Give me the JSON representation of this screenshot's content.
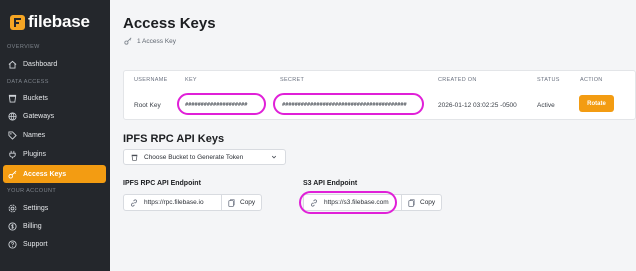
{
  "brand": {
    "name": "filebase",
    "accent": "#f39c12"
  },
  "sidebar": {
    "sections": {
      "overview": "OVERVIEW",
      "data_access": "DATA ACCESS",
      "your_account": "YOUR ACCOUNT"
    },
    "items": [
      {
        "label": "Dashboard",
        "icon": "home-icon"
      },
      {
        "label": "Buckets",
        "icon": "bucket-icon"
      },
      {
        "label": "Gateways",
        "icon": "globe-icon"
      },
      {
        "label": "Names",
        "icon": "tag-icon"
      },
      {
        "label": "Plugins",
        "icon": "plug-icon"
      },
      {
        "label": "Access Keys",
        "icon": "key-icon",
        "active": true
      },
      {
        "label": "Settings",
        "icon": "gear-icon"
      },
      {
        "label": "Billing",
        "icon": "billing-icon"
      },
      {
        "label": "Support",
        "icon": "help-icon"
      }
    ]
  },
  "main": {
    "title": "Access Keys",
    "key_count": "1 Access Key",
    "table": {
      "headers": {
        "username": "USERNAME",
        "key": "KEY",
        "secret": "SECRET",
        "created_on": "CREATED ON",
        "status": "STATUS",
        "action": "ACTION"
      },
      "row": {
        "username": "Root Key",
        "key": "####################",
        "secret": "########################################",
        "created_on": "2026-01-12 03:02:25 -0500",
        "status": "Active",
        "action": "Rotate"
      }
    },
    "ipfs_section_title": "IPFS RPC API Keys",
    "bucket_select": "Choose Bucket to Generate Token",
    "rpc_endpoint": {
      "label": "IPFS RPC API Endpoint",
      "url": "https://rpc.filebase.io",
      "copy": "Copy"
    },
    "s3_endpoint": {
      "label": "S3 API Endpoint",
      "url": "https://s3.filebase.com",
      "copy": "Copy"
    }
  }
}
